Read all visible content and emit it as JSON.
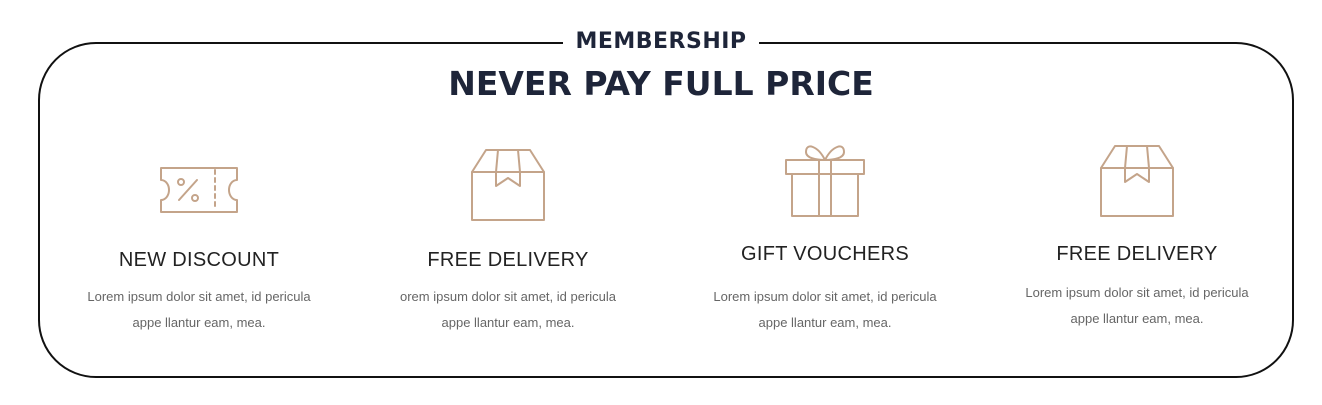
{
  "membership_label": "MEMBERSHIP",
  "headline": "NEVER PAY FULL PRICE",
  "accent_color": "#c4a48a",
  "features": [
    {
      "icon": "ticket-percent-icon",
      "title": "NEW DISCOUNT",
      "desc_line1": "Lorem ipsum dolor sit amet, id pericula",
      "desc_line2": "appe llantur eam, mea."
    },
    {
      "icon": "box-icon",
      "title": "FREE DELIVERY",
      "desc_line1": "orem ipsum dolor sit amet, id pericula",
      "desc_line2": "appe llantur eam, mea."
    },
    {
      "icon": "gift-icon",
      "title": "GIFT VOUCHERS",
      "desc_line1": "Lorem ipsum dolor sit amet, id pericula",
      "desc_line2": "appe llantur eam, mea."
    },
    {
      "icon": "box-icon",
      "title": "FREE DELIVERY",
      "desc_line1": "Lorem ipsum dolor sit amet, id pericula",
      "desc_line2": "appe llantur eam, mea."
    }
  ]
}
